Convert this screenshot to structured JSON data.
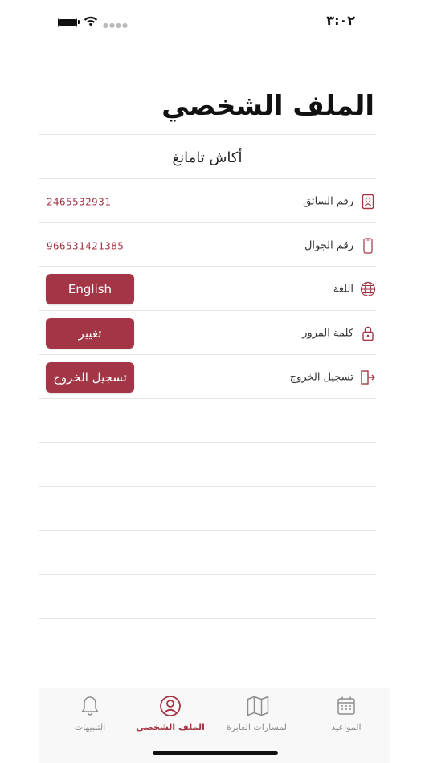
{
  "status_bar": {
    "time": "٣:٠٢",
    "icons": [
      "battery-icon",
      "wifi-icon",
      "signal-icon"
    ]
  },
  "page": {
    "title": "الملف الشخصي"
  },
  "user": {
    "name": "أكاش   تامانغ"
  },
  "rows": [
    {
      "label": "رقم السائق",
      "value": "2465532931",
      "icon": "id-card-icon"
    },
    {
      "label": "رقم الجوال",
      "value": "966531421385",
      "icon": "phone-icon"
    },
    {
      "label": "اللغة",
      "button": "English",
      "icon": "globe-icon"
    },
    {
      "label": "كلمة المرور",
      "button": "تغيير",
      "icon": "lock-icon"
    },
    {
      "label": "تسجيل الخروج",
      "button": "تسجيل الخروج",
      "icon": "logout-icon"
    }
  ],
  "tab_bar": {
    "tabs": [
      {
        "label": "المواعيد",
        "icon": "calendar-icon",
        "active": false
      },
      {
        "label": "المسارات العابرة",
        "icon": "map-icon",
        "active": false
      },
      {
        "label": "الملف الشخصي",
        "icon": "profile-icon",
        "active": true
      },
      {
        "label": "التنبيهات",
        "icon": "bell-icon",
        "active": false
      }
    ]
  },
  "colors": {
    "accent": "#a33646",
    "inactive_tab": "#8e8e8e",
    "divider": "#e4e4e4"
  }
}
